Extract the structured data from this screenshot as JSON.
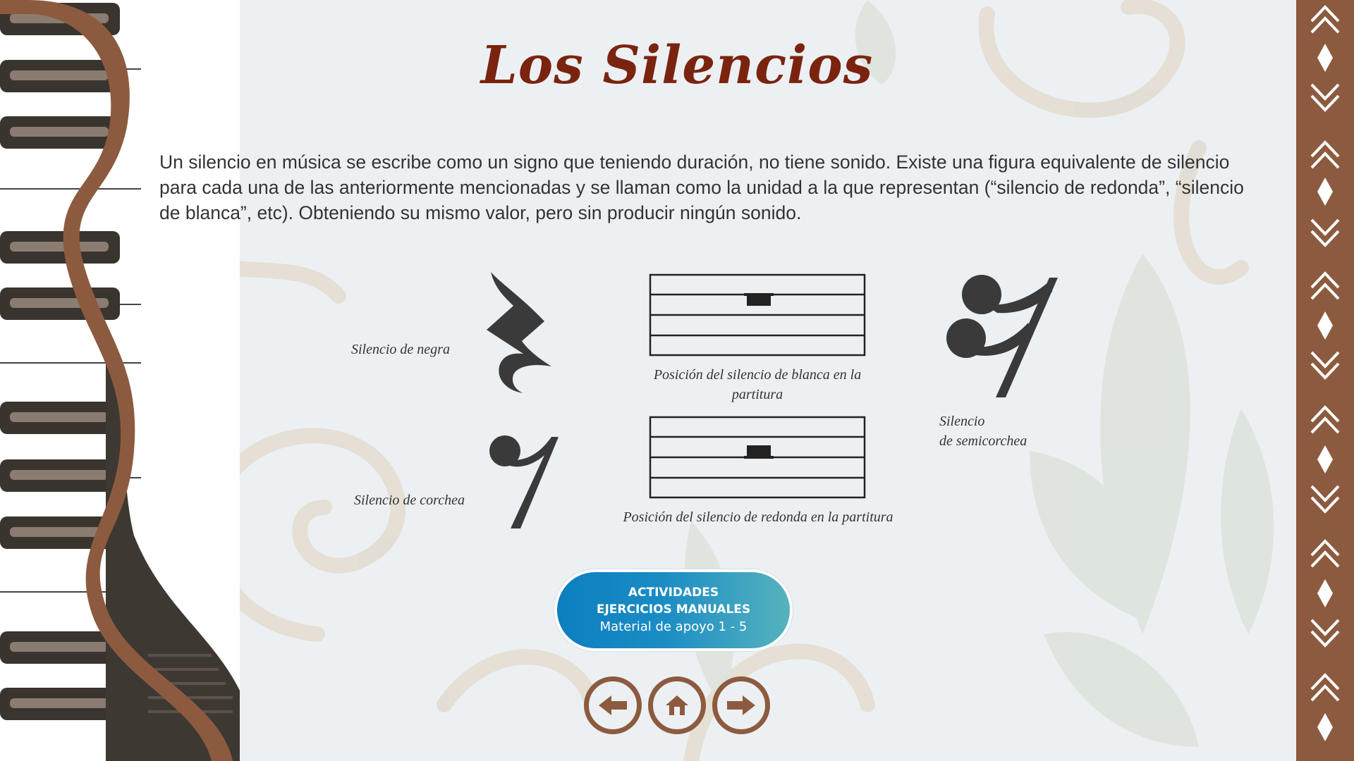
{
  "title": "Los Silencios",
  "intro": "Un silencio en música se escribe como un signo que teniendo duración, no tiene sonido. Existe una figura equivalente de silencio para cada una de las anteriormente mencionadas y se llaman como la unidad a la que representan (“silencio de redonda”, “silencio de blanca”, etc). Obteniendo su mismo valor, pero sin producir ningún sonido.",
  "figures": {
    "negra_label": "Silencio de negra",
    "corchea_label": "Silencio de corchea",
    "blanca_caption": "Posición del silencio de blanca en la partitura",
    "redonda_caption": "Posición del silencio de redonda en la partitura",
    "semicorchea_line1": "Silencio",
    "semicorchea_line2": "de semicorchea"
  },
  "activity_button": {
    "line1": "ACTIVIDADES",
    "line2": "EJERCICIOS MANUALES",
    "line3": "Material de apoyo 1 - 5"
  },
  "nav": {
    "back_icon": "arrow-left-icon",
    "home_icon": "home-icon",
    "next_icon": "arrow-right-icon"
  },
  "colors": {
    "background": "#edf0f3",
    "brown": "#8c5b3f",
    "title": "#7a2410",
    "button_start": "#0c7fbf",
    "button_end": "#56b3bd"
  }
}
